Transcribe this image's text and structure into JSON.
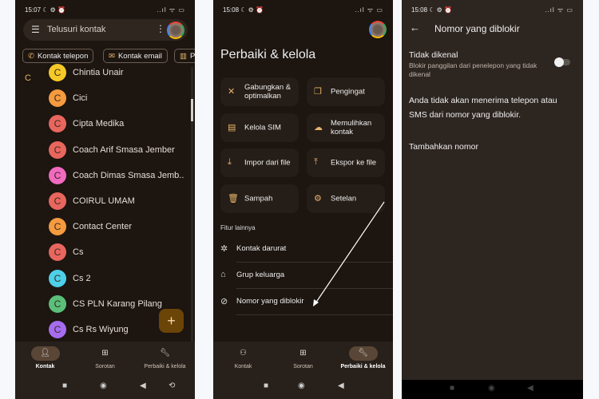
{
  "screen1": {
    "status": {
      "time": "15:07",
      "icons": "☾ ⚙ ⏰",
      "right": "..ıl ᯤ ▭"
    },
    "search": {
      "placeholder": "Telusuri kontak",
      "menu_icon": "hamburger-icon",
      "more_icon": "more-vert-icon"
    },
    "chips": [
      {
        "label": "Kontak telepon",
        "icon": "phone-icon"
      },
      {
        "label": "Kontak email",
        "icon": "mail-icon"
      },
      {
        "label": "P",
        "icon": "building-icon"
      }
    ],
    "section_letter": "C",
    "contacts": [
      {
        "initial": "C",
        "name": "Chintia Unair",
        "color": "#f6c928"
      },
      {
        "initial": "C",
        "name": "Cici",
        "color": "#f59a3f"
      },
      {
        "initial": "C",
        "name": "Cipta Medika",
        "color": "#e8665e"
      },
      {
        "initial": "C",
        "name": "Coach Arif Smasa Jember",
        "color": "#e8665e"
      },
      {
        "initial": "C",
        "name": "Coach Dimas Smasa Jemb..",
        "color": "#f06ac0"
      },
      {
        "initial": "C",
        "name": "COIRUL UMAM",
        "color": "#e8665e"
      },
      {
        "initial": "C",
        "name": "Contact Center",
        "color": "#f59a3f"
      },
      {
        "initial": "C",
        "name": "Cs",
        "color": "#e8665e"
      },
      {
        "initial": "C",
        "name": "Cs 2",
        "color": "#4dd0e8"
      },
      {
        "initial": "C",
        "name": "CS PLN Karang Pilang",
        "color": "#5bbf7a"
      },
      {
        "initial": "C",
        "name": "Cs Rs Wiyung",
        "color": "#a56cf0"
      }
    ],
    "fab": "+",
    "nav": [
      {
        "label": "Kontak",
        "active": true
      },
      {
        "label": "Sorotan"
      },
      {
        "label": "Perbaiki & kelola"
      }
    ]
  },
  "screen2": {
    "status": {
      "time": "15:08",
      "icons": "☾ ⚙ ⏰",
      "right": "..ıl ᯤ ▭"
    },
    "title": "Perbaiki & kelola",
    "tiles": [
      {
        "label": "Gabungkan & optimalkan",
        "icon": "merge-tools-icon"
      },
      {
        "label": "Pengingat",
        "icon": "reminder-icon"
      },
      {
        "label": "Kelola SIM",
        "icon": "sim-icon"
      },
      {
        "label": "Memulihkan kontak",
        "icon": "cloud-restore-icon"
      },
      {
        "label": "Impor dari file",
        "icon": "import-icon"
      },
      {
        "label": "Ekspor ke file",
        "icon": "export-icon"
      },
      {
        "label": "Sampah",
        "icon": "trash-icon"
      },
      {
        "label": "Setelan",
        "icon": "settings-icon"
      }
    ],
    "section": "Fitur lainnya",
    "list": [
      {
        "label": "Kontak darurat",
        "icon": "emergency-icon"
      },
      {
        "label": "Grup keluarga",
        "icon": "family-icon"
      },
      {
        "label": "Nomor yang diblokir",
        "icon": "block-icon"
      }
    ],
    "nav": [
      {
        "label": "Kontak"
      },
      {
        "label": "Sorotan"
      },
      {
        "label": "Perbaiki & kelola",
        "active": true
      }
    ]
  },
  "screen3": {
    "status": {
      "time": "15:08",
      "icons": "☾ ⚙ ⏰",
      "right": "..ıl ᯤ ▭"
    },
    "title": "Nomor yang diblokir",
    "unknown": {
      "title": "Tidak dikenal",
      "desc": "Blokir panggilan dari penelepon yang tidak dikenal",
      "enabled": false
    },
    "info": "Anda tidak akan menerima telepon atau SMS dari nomor yang diblokir.",
    "add": "Tambahkan nomor"
  },
  "colors": {
    "accent": "#e8b46b",
    "background": "#1c1510"
  }
}
